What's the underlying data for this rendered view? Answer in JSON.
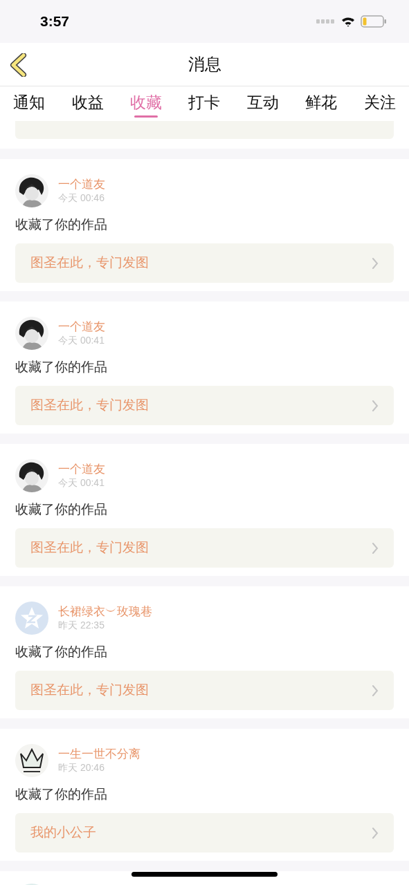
{
  "status_bar": {
    "time": "3:57"
  },
  "nav": {
    "title": "消息"
  },
  "tabs": [
    {
      "label": "通知",
      "selected": false
    },
    {
      "label": "收益",
      "selected": false
    },
    {
      "label": "收藏",
      "selected": true
    },
    {
      "label": "打卡",
      "selected": false
    },
    {
      "label": "互动",
      "selected": false
    },
    {
      "label": "鲜花",
      "selected": false
    },
    {
      "label": "关注",
      "selected": false
    }
  ],
  "messages": [
    {
      "user": "一个道友",
      "time": "今天 00:46",
      "action": "收藏了你的作品",
      "work": "图圣在此，专门发图"
    },
    {
      "user": "一个道友",
      "time": "今天 00:41",
      "action": "收藏了你的作品",
      "work": "图圣在此，专门发图"
    },
    {
      "user": "一个道友",
      "time": "今天 00:41",
      "action": "收藏了你的作品",
      "work": "图圣在此，专门发图"
    },
    {
      "user": "长裙绿衣︶玫瑰巷",
      "time": "昨天 22:35",
      "action": "收藏了你的作品",
      "work": "图圣在此，专门发图",
      "avatar": {
        "kind": "placeholder"
      }
    },
    {
      "user": "一生一世不分离",
      "time": "昨天 20:46",
      "action": "收藏了你的作品",
      "work": "我的小公子"
    }
  ]
}
